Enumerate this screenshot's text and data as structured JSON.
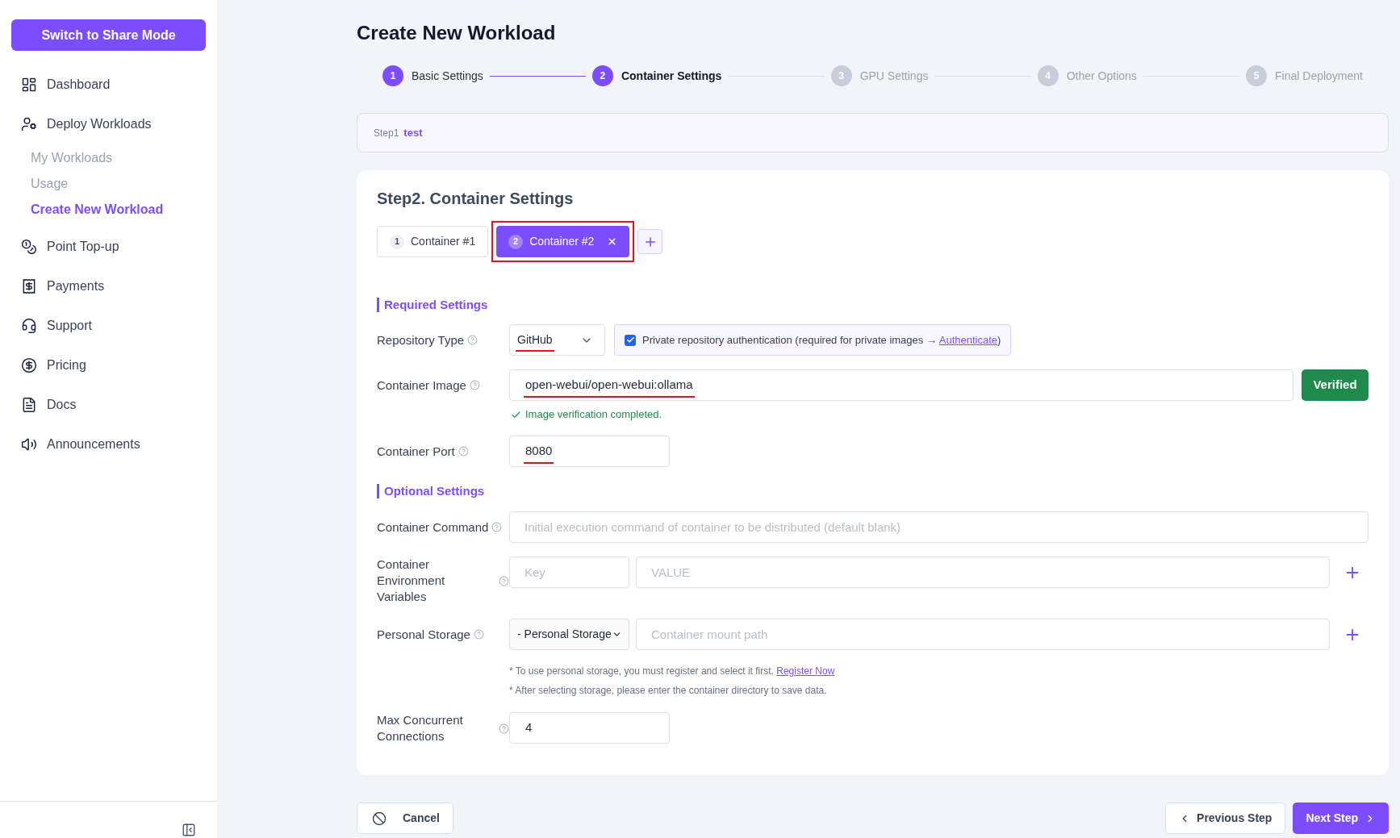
{
  "sidebar": {
    "mode_button": "Switch to Share Mode",
    "items": [
      {
        "label": "Dashboard",
        "selected": false
      },
      {
        "label": "Deploy Workloads",
        "selected": false,
        "children": [
          {
            "label": "My Workloads",
            "selected": false
          },
          {
            "label": "Usage",
            "selected": false
          },
          {
            "label": "Create New Workload",
            "selected": true
          }
        ]
      },
      {
        "label": "Point Top-up",
        "selected": false
      },
      {
        "label": "Payments",
        "selected": false
      },
      {
        "label": "Support",
        "selected": false
      },
      {
        "label": "Pricing",
        "selected": false
      },
      {
        "label": "Docs",
        "selected": false
      },
      {
        "label": "Announcements",
        "selected": false
      }
    ]
  },
  "page": {
    "title": "Create New Workload",
    "steps": [
      {
        "number": "1",
        "label": "Basic Settings",
        "completed": true,
        "selected": false
      },
      {
        "number": "2",
        "label": "Container Settings",
        "completed": false,
        "selected": true
      },
      {
        "number": "3",
        "label": "GPU Settings",
        "completed": false,
        "selected": false
      },
      {
        "number": "4",
        "label": "Other Options",
        "completed": false,
        "selected": false
      },
      {
        "number": "5",
        "label": "Final Deployment",
        "completed": false,
        "selected": false
      }
    ],
    "summary": {
      "label": "Step1",
      "value": "test"
    }
  },
  "form": {
    "title": "Step2. Container Settings",
    "container_tabs": [
      {
        "number": "1",
        "label": "Container #1",
        "selected": false,
        "closable": false,
        "highlighted": false
      },
      {
        "number": "2",
        "label": "Container #2",
        "selected": true,
        "closable": true,
        "highlighted": true
      }
    ],
    "sections": [
      {
        "title": "Required Settings",
        "fields": [
          {
            "kind": "repository",
            "label": "Repository Type",
            "value": "GitHub",
            "underlined": true,
            "checkbox": {
              "label": "Private repository authentication (required for private images → ",
              "link": "Authenticate",
              "label_end": ")",
              "checked": true
            }
          },
          {
            "kind": "verify",
            "label": "Container Image",
            "value": "open-webui/open-webui:ollama",
            "underlined": true,
            "button": "Verified",
            "message": "Image verification completed."
          },
          {
            "kind": "number",
            "label": "Container Port",
            "value": "8080",
            "underlined": true
          }
        ]
      },
      {
        "title": "Optional Settings",
        "fields": [
          {
            "kind": "text",
            "label": "Container Command",
            "placeholder": "Initial execution command of container to be distributed (default blank)"
          },
          {
            "kind": "key_value",
            "label": "Container Environment Variables",
            "key_placeholder": "Key",
            "value_placeholder": "VALUE"
          },
          {
            "kind": "storage",
            "label": "Personal Storage",
            "value": "- Personal Storage",
            "underlined": false,
            "path_placeholder": "Container mount path",
            "notes": [
              {
                "text": "* To use personal storage, you must register and select it first.",
                "link": "Register Now"
              },
              {
                "text": "* After selecting storage, please enter the container directory to save data."
              }
            ]
          },
          {
            "kind": "number",
            "label": "Max Concurrent Connections",
            "value": "4",
            "underlined": false
          }
        ]
      }
    ]
  },
  "footer": {
    "cancel": "Cancel",
    "previous": "Previous Step",
    "next": "Next Step"
  }
}
